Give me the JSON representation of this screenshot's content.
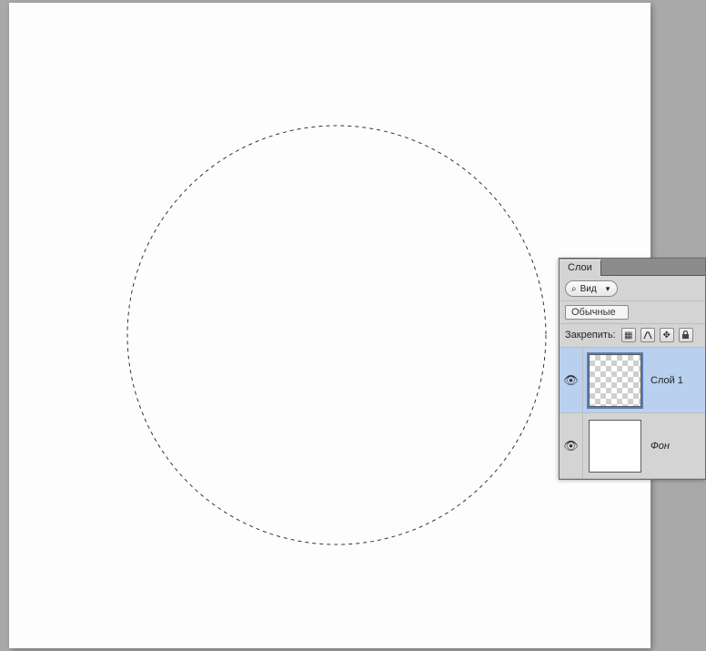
{
  "panel": {
    "tab_label": "Слои",
    "filter": {
      "label": "Вид"
    },
    "blend_mode": "Обычные",
    "lock_label": "Закрепить:"
  },
  "layers": [
    {
      "name": "Слой 1",
      "visible": true,
      "selected": true,
      "transparent": true
    },
    {
      "name": "Фон",
      "visible": true,
      "selected": false,
      "transparent": false,
      "isBackground": true
    }
  ]
}
